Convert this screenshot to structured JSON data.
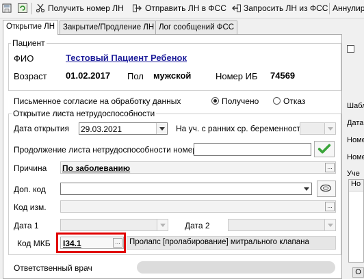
{
  "toolbar": {
    "get_ln": "Получить номер ЛН",
    "send_ln": "Отправить ЛН в ФСС",
    "request_ln": "Запросить ЛН из ФСС",
    "annul": "Аннулир"
  },
  "tabs": [
    "Открытие ЛН",
    "Закрытие/Продление ЛН",
    "Лог сообщений ФСС"
  ],
  "patient": {
    "legend": "Пациент",
    "fio_label": "ФИО",
    "fio_value": "Тестовый Пациент Ребенок",
    "age_label": "Возраст",
    "age_value": "01.02.2017",
    "sex_label": "Пол",
    "sex_value": "мужской",
    "ib_label": "Номер ИБ",
    "ib_value": "74569"
  },
  "consent": {
    "label": "Письменное согласие на обработку данных",
    "option_yes": "Получено",
    "option_no": "Отказ",
    "selected": "Получено"
  },
  "opening": {
    "legend": "Открытие листа нетрудоспособности",
    "date_label": "Дата открытия",
    "date_value": "29.03.2021",
    "pregnancy_label": "На уч. с ранних ср. беременности",
    "continuation_label": "Продолжение листа нетрудоспособности номер",
    "reason_label": "Причина",
    "reason_value": "По заболеванию",
    "dop_kod_label": "Доп. код",
    "kod_izm_label": "Код изм.",
    "date1_label": "Дата 1",
    "date2_label": "Дата 2",
    "mkb_label": "Код МКБ",
    "mkb_value": "I34.1",
    "mkb_desc": "Пролапс [пролабирование] митрального клапана"
  },
  "doctor_label": "Ответственный врач",
  "right_panel": {
    "shabl": "Шабл",
    "data": "Дата",
    "nome1": "Номе",
    "nome2": "Номе",
    "uche": "Уче",
    "no": "Но",
    "ok": "О"
  },
  "colors": {
    "link_blue": "#1f1f9a",
    "highlight_red": "#e00000",
    "check_green": "#3aa53a"
  }
}
